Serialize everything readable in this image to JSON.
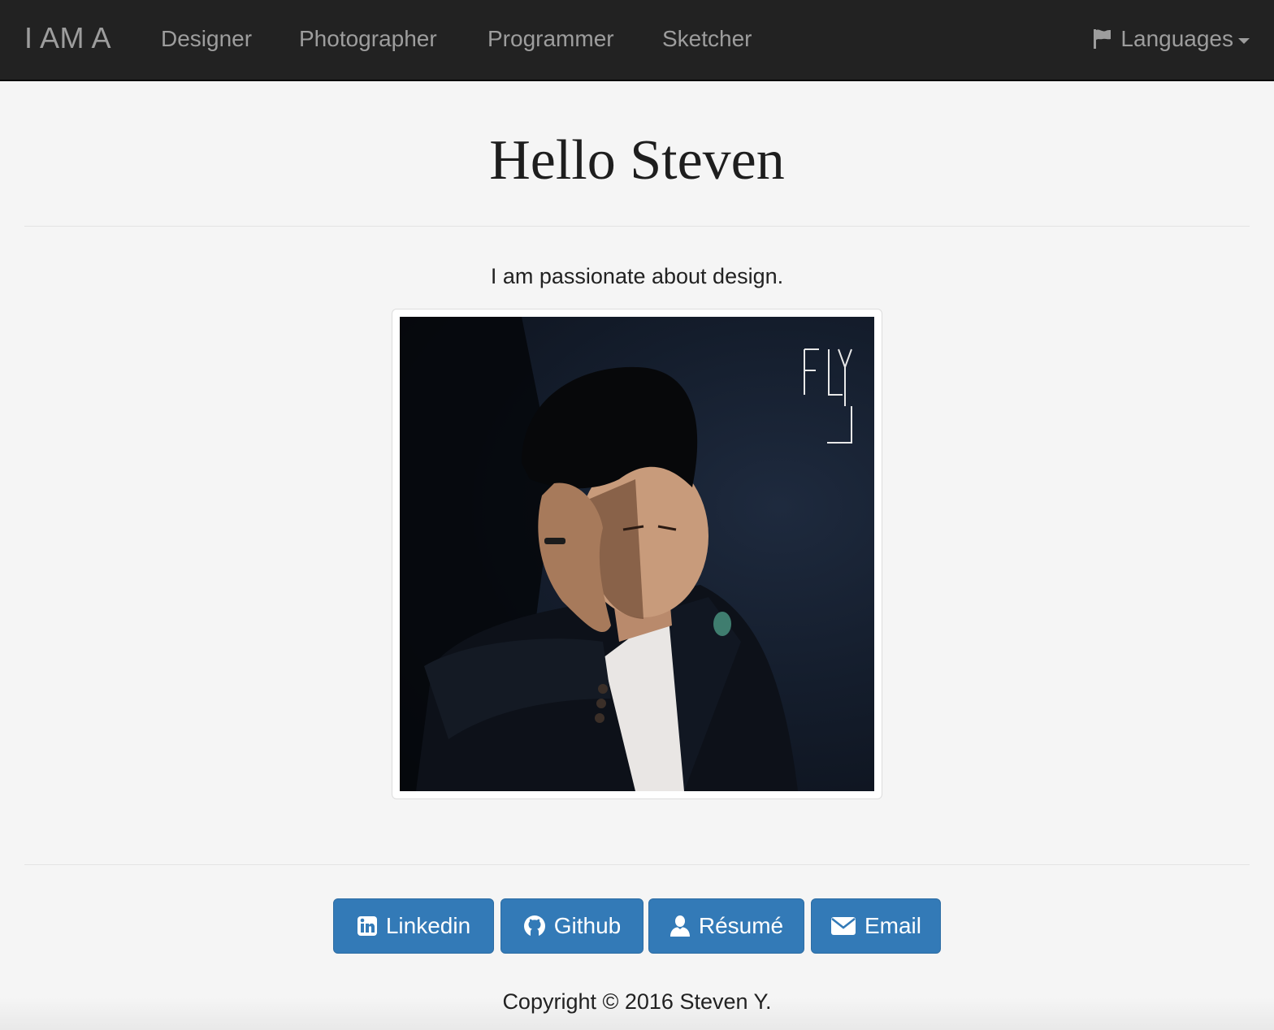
{
  "navbar": {
    "brand": "I AM A",
    "links": [
      "Designer",
      "Photographer",
      "Programmer",
      "Sketcher"
    ],
    "languages_label": "Languages",
    "languages_icon": "flag-icon"
  },
  "main": {
    "title": "Hello Steven",
    "tagline": "I am passionate about design.",
    "photo_watermark": "FLY"
  },
  "buttons": [
    {
      "label": "Linkedin",
      "icon": "linkedin-icon"
    },
    {
      "label": "Github",
      "icon": "github-icon"
    },
    {
      "label": "Résumé",
      "icon": "user-icon"
    },
    {
      "label": "Email",
      "icon": "envelope-icon"
    }
  ],
  "footer": {
    "copyright": "Copyright © 2016 Steven Y."
  },
  "colors": {
    "navbar_bg": "#222222",
    "nav_text": "#9d9d9d",
    "page_bg": "#f5f5f5",
    "button_primary": "#337ab7"
  }
}
